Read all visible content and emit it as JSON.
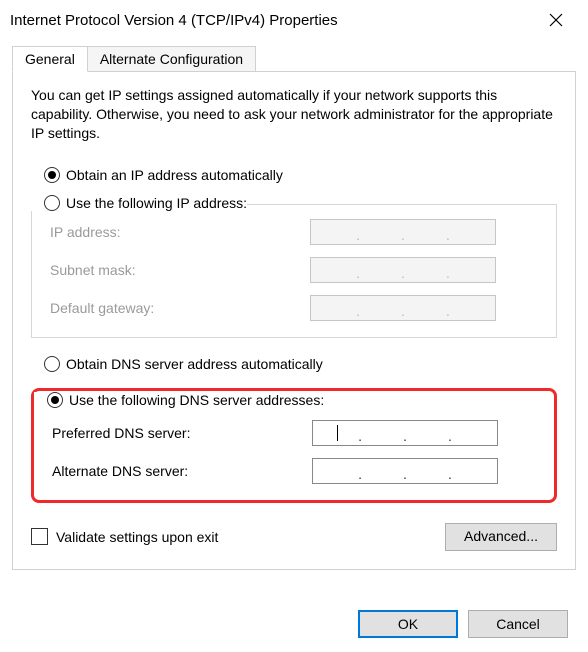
{
  "window": {
    "title": "Internet Protocol Version 4 (TCP/IPv4) Properties"
  },
  "tabs": {
    "general": "General",
    "alternate": "Alternate Configuration"
  },
  "intro": "You can get IP settings assigned automatically if your network supports this capability. Otherwise, you need to ask your network administrator for the appropriate IP settings.",
  "ip": {
    "auto_label": "Obtain an IP address automatically",
    "manual_label": "Use the following IP address:",
    "address_label": "IP address:",
    "subnet_label": "Subnet mask:",
    "gateway_label": "Default gateway:",
    "ip_address": "",
    "subnet_mask": "",
    "default_gateway": ""
  },
  "dns": {
    "auto_label": "Obtain DNS server address automatically",
    "manual_label": "Use the following DNS server addresses:",
    "preferred_label": "Preferred DNS server:",
    "alternate_label": "Alternate DNS server:",
    "preferred_dns": "",
    "alternate_dns": ""
  },
  "validate_label": "Validate settings upon exit",
  "buttons": {
    "advanced": "Advanced...",
    "ok": "OK",
    "cancel": "Cancel"
  }
}
